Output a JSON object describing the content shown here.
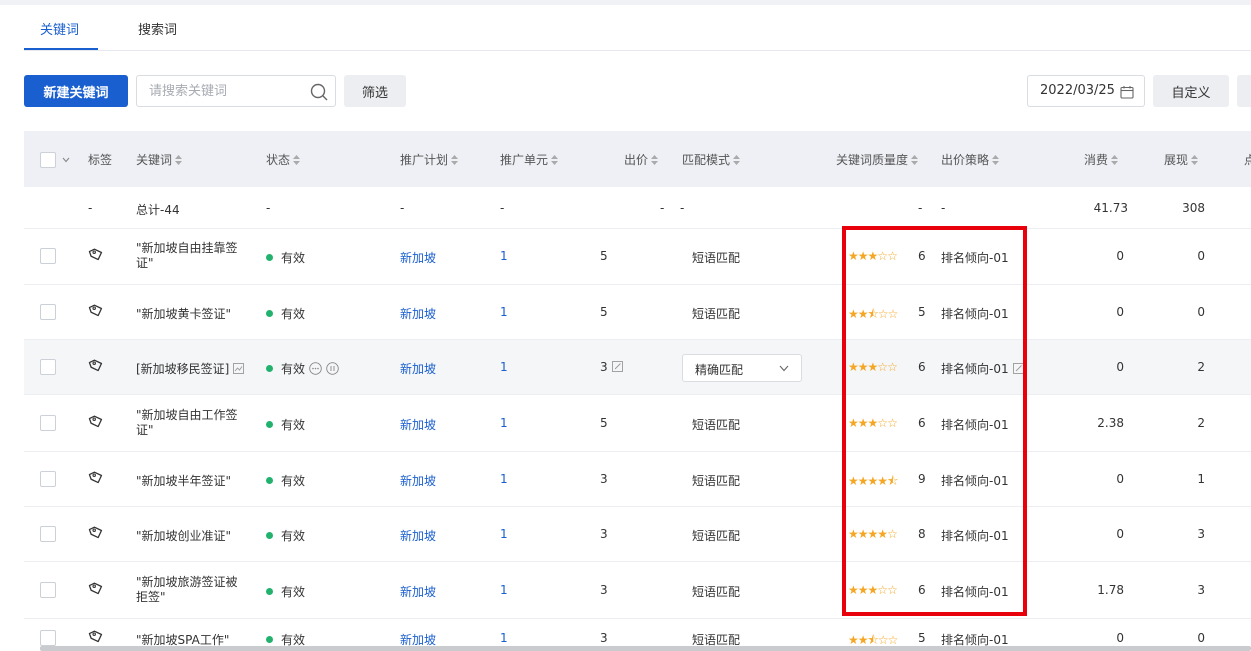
{
  "tabs": [
    {
      "label": "关键词",
      "active": true
    },
    {
      "label": "搜索词",
      "active": false
    }
  ],
  "toolbar": {
    "new_label": "新建关键词",
    "search_placeholder": "请搜索关键词",
    "filter_label": "筛选",
    "date": "2022/03/25",
    "custom_label": "自定义"
  },
  "columns": {
    "tag": "标签",
    "keyword": "关键词",
    "status": "状态",
    "plan": "推广计划",
    "unit": "推广单元",
    "bid": "出价",
    "match": "匹配模式",
    "quality": "关键词质量度",
    "strategy": "出价策略",
    "cost": "消费",
    "impressions": "展现",
    "clicks": "点"
  },
  "total": {
    "tag": "-",
    "keyword": "总计-44",
    "status": "-",
    "plan": "-",
    "unit": "-",
    "bid": "-",
    "match": "-",
    "quality": "-",
    "strategy": "-",
    "cost": "41.73",
    "impressions": "308"
  },
  "rows": [
    {
      "keyword": "\"新加坡自由挂靠签证\"",
      "status": "有效",
      "plan": "新加坡",
      "unit": "1",
      "bid": "5",
      "match": "短语匹配",
      "stars": 3,
      "quality": "6",
      "strategy": "排名倾向-01",
      "cost": "0",
      "impressions": "0"
    },
    {
      "keyword": "\"新加坡黄卡签证\"",
      "status": "有效",
      "plan": "新加坡",
      "unit": "1",
      "bid": "5",
      "match": "短语匹配",
      "stars": 2.5,
      "quality": "5",
      "strategy": "排名倾向-01",
      "cost": "0",
      "impressions": "0"
    },
    {
      "keyword": "[新加坡移民签证]",
      "status": "有效",
      "plan": "新加坡",
      "unit": "1",
      "bid": "3",
      "match": "精确匹配",
      "stars": 3,
      "quality": "6",
      "strategy": "排名倾向-01",
      "cost": "0",
      "impressions": "2"
    },
    {
      "keyword": "\"新加坡自由工作签证\"",
      "status": "有效",
      "plan": "新加坡",
      "unit": "1",
      "bid": "5",
      "match": "短语匹配",
      "stars": 3,
      "quality": "6",
      "strategy": "排名倾向-01",
      "cost": "2.38",
      "impressions": "2"
    },
    {
      "keyword": "\"新加坡半年签证\"",
      "status": "有效",
      "plan": "新加坡",
      "unit": "1",
      "bid": "3",
      "match": "短语匹配",
      "stars": 4.5,
      "quality": "9",
      "strategy": "排名倾向-01",
      "cost": "0",
      "impressions": "1"
    },
    {
      "keyword": "\"新加坡创业准证\"",
      "status": "有效",
      "plan": "新加坡",
      "unit": "1",
      "bid": "3",
      "match": "短语匹配",
      "stars": 4,
      "quality": "8",
      "strategy": "排名倾向-01",
      "cost": "0",
      "impressions": "3"
    },
    {
      "keyword": "\"新加坡旅游签证被拒签\"",
      "status": "有效",
      "plan": "新加坡",
      "unit": "1",
      "bid": "3",
      "match": "短语匹配",
      "stars": 3,
      "quality": "6",
      "strategy": "排名倾向-01",
      "cost": "1.78",
      "impressions": "3"
    },
    {
      "keyword": "\"新加坡SPA工作\"",
      "status": "有效",
      "plan": "新加坡",
      "unit": "1",
      "bid": "3",
      "match": "短语匹配",
      "stars": 2.5,
      "quality": "5",
      "strategy": "排名倾向-01",
      "cost": "0",
      "impressions": "0"
    }
  ],
  "colors": {
    "accent": "#1a5fcf",
    "status_ok": "#23b26d",
    "star": "#f5a623",
    "highlight_box": "#e8000b"
  }
}
